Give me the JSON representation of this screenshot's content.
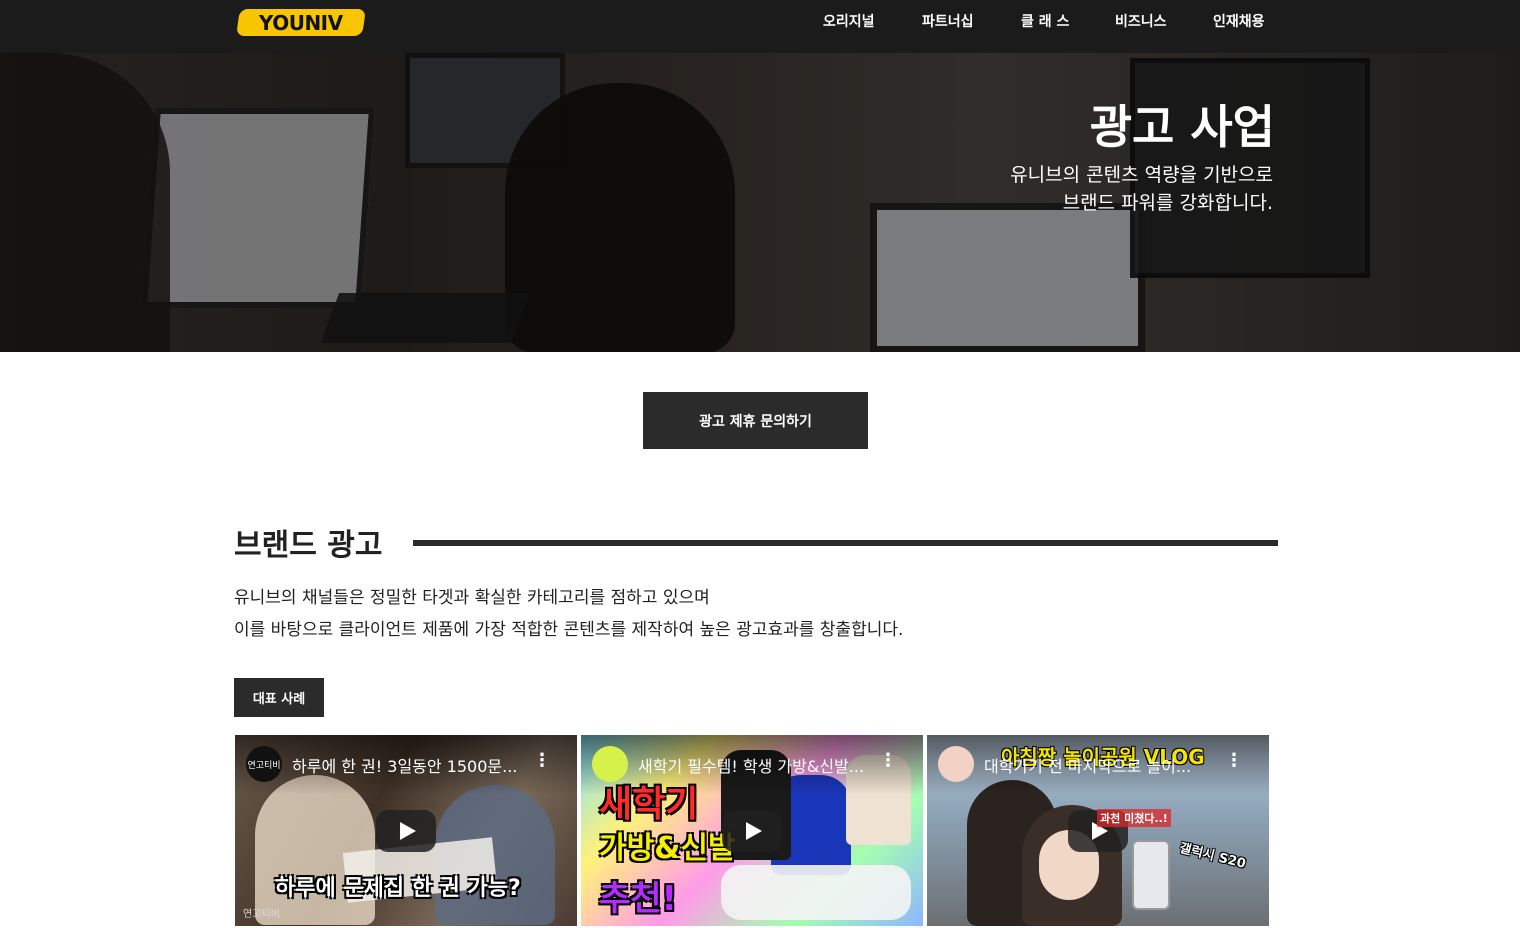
{
  "header": {
    "logo_text": "YOUNIV",
    "nav": [
      "오리지널",
      "파트너십",
      "클 래 스",
      "비즈니스",
      "인재채용"
    ]
  },
  "hero": {
    "title": "광고 사업",
    "subtitle_line1": "유니브의 콘텐츠 역량을 기반으로",
    "subtitle_line2": "브랜드 파워를 강화합니다."
  },
  "cta": {
    "label": "광고 제휴 문의하기"
  },
  "section": {
    "title": "브랜드 광고",
    "desc_line1": "유니브의 채널들은 정밀한 타겟과 확실한 카테고리를 점하고 있으며",
    "desc_line2": "이를 바탕으로 클라이언트 제품에 가장 적합한 콘텐츠를 제작하여 높은 광고효과를 창출합니다.",
    "tag": "대표 사례"
  },
  "videos": [
    {
      "avatar_text": "연고티비",
      "title": "하루에 한 권! 3일동안 1500문...",
      "caption": "하루에 문제집 한 권 가능?",
      "watermark": "연고티비"
    },
    {
      "avatar_text": "",
      "title": "새학기 필수템! 학생 가방&신발...",
      "caption_line1": "새학기",
      "caption_line2": "가방&신발",
      "caption_line3": "추천!"
    },
    {
      "avatar_text": "",
      "title": "대학가기 전 마지막으로 놀이...",
      "caption_top": "아침짱 놀이공원 VLOG",
      "caption_side": "갤럭시 S20",
      "caption_small": "과천 미쳤다..!"
    }
  ],
  "colors": {
    "header_bg": "#1b1b1b",
    "logo_yellow": "#f7c600",
    "dark_button": "#2b2b2b"
  }
}
